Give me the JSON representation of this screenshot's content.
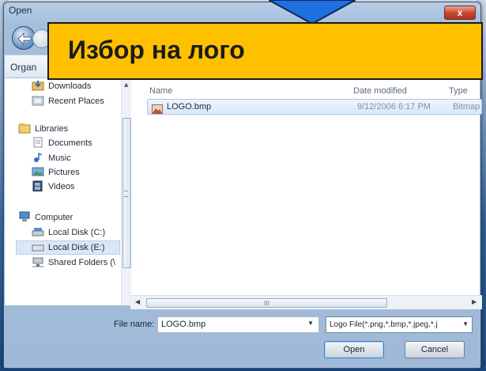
{
  "window": {
    "title": "Open",
    "close_glyph": "x"
  },
  "toolbar": {
    "organize": "Organ"
  },
  "caption": {
    "text": "Избор на лого"
  },
  "sidebar": {
    "items": [
      {
        "label": "Downloads",
        "icon": "downloads-icon"
      },
      {
        "label": "Recent Places",
        "icon": "recent-places-icon"
      },
      {
        "label": "Libraries",
        "icon": "libraries-icon"
      },
      {
        "label": "Documents",
        "icon": "documents-icon"
      },
      {
        "label": "Music",
        "icon": "music-icon"
      },
      {
        "label": "Pictures",
        "icon": "pictures-icon"
      },
      {
        "label": "Videos",
        "icon": "videos-icon"
      },
      {
        "label": "Computer",
        "icon": "computer-icon"
      },
      {
        "label": "Local Disk (C:)",
        "icon": "drive-icon"
      },
      {
        "label": "Local Disk (E:)",
        "icon": "drive-icon",
        "selected": true
      },
      {
        "label": "Shared Folders (\\",
        "icon": "shared-folder-icon"
      }
    ]
  },
  "file_list": {
    "columns": [
      "Name",
      "Date modified",
      "Type"
    ],
    "rows": [
      {
        "name": "LOGO.bmp",
        "date": "9/12/2006 6:17 PM",
        "type": "Bitmap in"
      }
    ]
  },
  "footer": {
    "file_name_label": "File name:",
    "file_name_value": "LOGO.bmp",
    "file_type_value": "Logo File(*.png,*.bmp,*.jpeg,*.j",
    "open_label": "Open",
    "cancel_label": "Cancel"
  },
  "scroll": {
    "grip": "III"
  },
  "colors": {
    "caption_bg": "#ffc000",
    "arrow": "#1f6fe0",
    "selection": "#d9e8fb"
  }
}
